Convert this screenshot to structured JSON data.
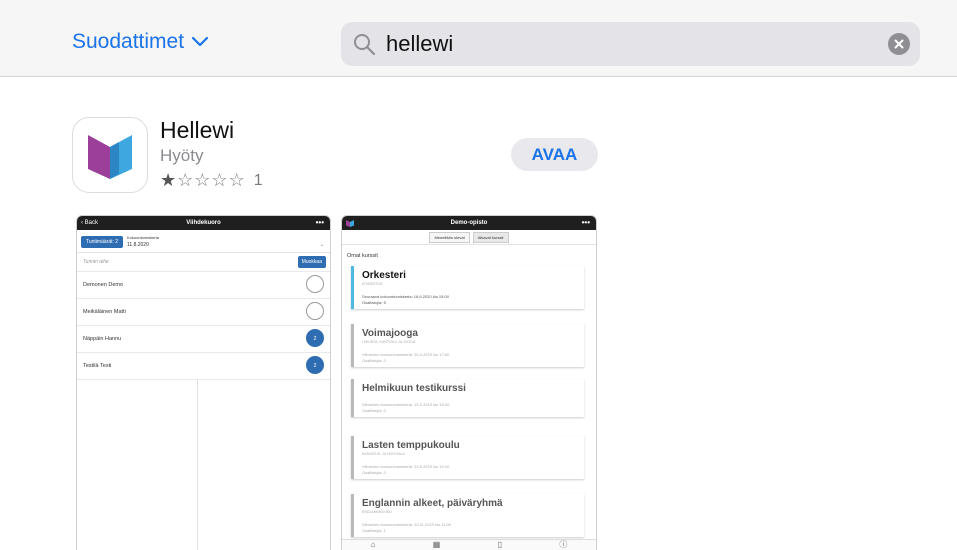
{
  "header": {
    "filters_label": "Suodattimet",
    "search_value": "hellewi"
  },
  "app": {
    "name": "Hellewi",
    "category": "Hyöty",
    "rating_stars": 1,
    "rating_max": 5,
    "rating_count": "1",
    "open_label": "AVAA"
  },
  "screenshot1": {
    "nav": {
      "back": "Back",
      "title": "Viihdekuoro",
      "more": "•••"
    },
    "tunnit_button": "Tuntimäärät: 2",
    "kokoontumis_label": "Kokoontumiskerta",
    "date": "11.8.2020",
    "search_placeholder": "Tunnin aihe",
    "edit_label": "Muokkaa",
    "rows": [
      {
        "name": "Demonen Demo",
        "value": "",
        "checked": false
      },
      {
        "name": "Meikäläinen Matti",
        "value": "",
        "checked": false
      },
      {
        "name": "Näppäin Hannu",
        "value": "2",
        "checked": true
      },
      {
        "name": "Testilä Testi",
        "value": "2",
        "checked": true
      }
    ]
  },
  "screenshot2": {
    "nav": {
      "title": "Demo-opisto",
      "more": "•••"
    },
    "tabs": [
      "Menellään olevat",
      "Alkavat kurssit"
    ],
    "section": "Omat kurssit",
    "cards": [
      {
        "title": "Orkesteri",
        "sub": "KITARISTUS",
        "meta1": "Seuraava kokoontumiskerta: 16.6.2020 klo 15:00",
        "meta2": "Osallistujia: 5"
      },
      {
        "title": "Voimajooga",
        "sub": "LIIKUNTA, KUNTOILU JA JOOGA",
        "meta1": "Viimeinen kokoontumiskerta: 29.4.2019 klo 17:00",
        "meta2": "Osallistujia: 0"
      },
      {
        "title": "Helmikuun testikurssi",
        "sub": "",
        "meta1": "Viimeinen kokoontumiskerta: 15.2.2019 klo 15:00",
        "meta2": "Osallistujia: 0"
      },
      {
        "title": "Lasten temppukoulu",
        "sub": "KASVATUS- JA HOITOALA",
        "meta1": "Viimeinen kokoontumiskerta: 23.5.2019 klo 19:00",
        "meta2": "Osallistujia: 0"
      },
      {
        "title": "Englannin alkeet, päiväryhmä",
        "sub": "ENGLANNIN KIELI",
        "meta1": "Viimeinen kokoontumiskerta: 20.11.2019 klo 11:00",
        "meta2": "Osallistujia: 1"
      }
    ]
  },
  "colors": {
    "accent": "#1a73e8",
    "app_blue": "#2f6db3",
    "card_active": "#4fb9e0"
  }
}
